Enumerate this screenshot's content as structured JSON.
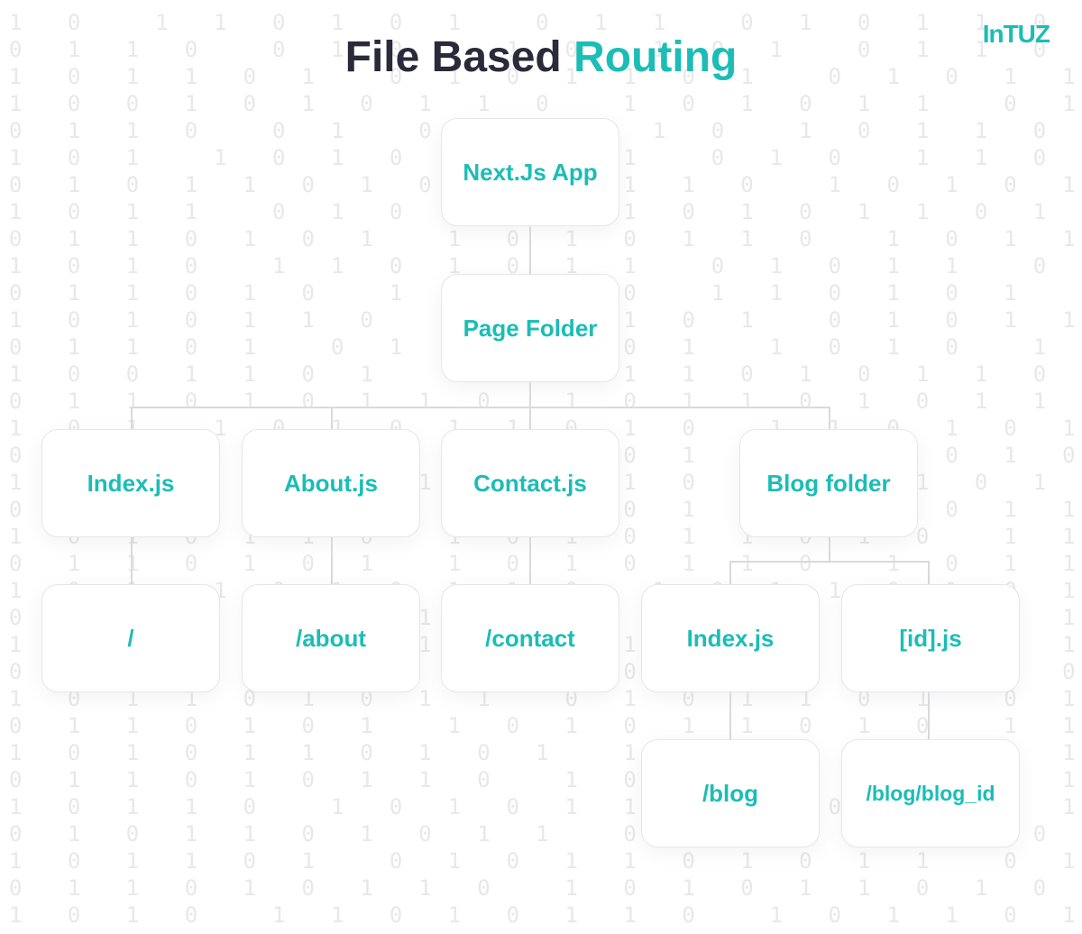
{
  "logo": "InTUZ",
  "title": {
    "part1": "File Based ",
    "part2": "Routing"
  },
  "nodes": {
    "root": "Next.Js App",
    "page_folder": "Page Folder",
    "index_js": "Index.js",
    "about_js": "About.js",
    "contact_js": "Contact.js",
    "blog_folder": "Blog folder",
    "route_root": "/",
    "route_about": "/about",
    "route_contact": "/contact",
    "blog_index": "Index.js",
    "blog_id": "[id].js",
    "route_blog": "/blog",
    "route_blog_id": "/blog/blog_id"
  },
  "binary_bg": "1 0  1 1 0 1 0 1  0 1 1  0 1 0 1 1 0 1 0 1 0 1\n0 1 1 0  0 1 0 1 1 0  1 0 1  0 1 1 0  1 0 1 1 0\n1 0 1 1 0 1  0 1 0 1 1 0 1  0 1 0 1 1 0  1 0 1\n1 0 0 1 0 1 0 1 1 0  1 0 1 0 1 1  0 1 0 1 1 0\n0 1 1 0  0 1  0 1 1 0 1 0  1 0 1 1 0 1 0  1 1 0\n1 0 1  1 0 1 0 1 1 0 1  0 1 0  1 1 0 1 0 1 1 0\n0 1 0 1 1 0 1 0  1 0 1 1 0  1 0 1 0 1  1 0 1 0\n1 0 1 1  0 1 0 1 1 0 1 0 1 0 1 1 0 1  0 1 1 0\n0 1 1 0 1 0 1  1 0 1 0 1 1 0  1 0 1 1 0 1 0 1\n1 0 1 0  1 1 0 1 0 1 1  0 1 0 1 1  0 1 0 1 1 0\n0 1 1 0 1 0  1 1 0 1 0  1 1 0 1 0 1  1 0 1 0 1\n1 0 1 0 1 1 0  1 0 1 1 0 1  0 1 0 1 1 0  1 1 0\n0 1 1 0 1  0 1 1 0 1 0 1  1 0 1 0  1 1 0 1 0 1\n1 0 0 1 1 0 1  0 1 0 1 1 0 1 0 1 1 0  1 0 1 1\n0 1 1 0 1 0 1 1 0  1 0 1 1 0 1 0 1 1 0  1 0 1\n1 0 1  1 0 1 0 1 1 0 1 0  1 1 0 1 0 1 1 0 1 0\n0 1 0 1 1 0 1  0 1 1 0 1 0 1  1 0 1 0 1 1  0 1\n1 0 1 1 0 1 0 1 1 0  1 0 1 1 0 1 0 1  1 0 1 0\n0 1 1 0  1 0 1 1 0 1 0 1 1  0 1 0 1 1 0 1  0 1\n1 0 1 0 1 1 0  1 0 1 0 1 1 0 1 0  1 1 0 1 0 1\n0 1 1 0 1 0 1  1 0 1 0 1 1 0  1 0 1 1  0 1 0 1\n1 0 1  1 0 1 0 1 1 0  1 0 1 1 0 1 0 1 1  0 1 0\n0 1 1 0 1 0 1 1 0 1 0  1 1 0 1 0 1  1 0 1 0 1\n1 0 1 0 1 1 0 1  0 1 1 0 1 0 1 1 0  1 0 1 1 0\n0 1 1 0  1 0 1 0 1 1 0 1 0 1 1  0 1 0 1 1 0 1\n1 0 1 1 0 1 0 1 1  0 1 0 1 1 0 1  0 1 0 1 1 0\n0 1 1 0 1 0 1  1 0 1 0 1 1 0 1 0  1 1 0 1 0 1\n1 0 1 0 1 1 0 1 0 1  1 0 1 0 1 1 0  1 0 1 1 0\n0 1 1 0 1 0 1 1 0  1 0 1 1 0 1 0 1  1 0 1 0 1\n1 0 1 1 0  1 0 1 0 1 1 0 1  0 1 1 0 1 0 1 1 0\n0 1 0 1 1 0 1 0 1 1  0 1 0 1 1 0 1 0  1 1 0 1\n1 0 1 1 0 1  0 1 0 1 1 0 1 0 1 1  0 1 0 1 1 0\n0 1 1 0 1 0 1 1 0  1 0 1 0 1 1 0 1 0 1 1 0 1\n1 0 1 0  1 1 0 1 0 1 1 0  1 0 1 1 0 1  0 1 0 1"
}
